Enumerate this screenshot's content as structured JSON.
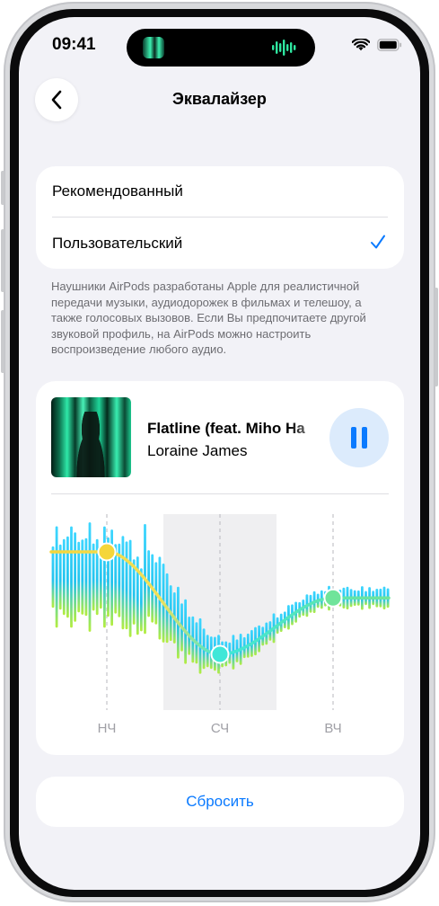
{
  "status_bar": {
    "time": "09:41"
  },
  "nav": {
    "title": "Эквалайзер"
  },
  "options": [
    {
      "label": "Рекомендованный",
      "selected": false
    },
    {
      "label": "Пользовательский",
      "selected": true
    }
  ],
  "footnote": "Наушники AirPods разработаны Apple для реалистичной передачи музыки, аудиодорожек в фильмах и телешоу, а также голосовых вызовов. Если Вы предпочитаете другой звуковой профиль, на AirPods можно настроить воспроизведение любого аудио.",
  "player": {
    "track_title": "Flatline (feat. Miho Ha",
    "artist": "Loraine James",
    "state": "playing"
  },
  "equalizer": {
    "bands": [
      {
        "label": "НЧ",
        "value": 1.0
      },
      {
        "label": "СЧ",
        "value": -1.0
      },
      {
        "label": "ВЧ",
        "value": 0.1
      }
    ],
    "handle_colors": [
      "#f5d63a",
      "#3fe7d8",
      "#6fe49a"
    ]
  },
  "actions": {
    "reset_label": "Сбросить"
  },
  "colors": {
    "accent": "#0a7aff",
    "background": "#f2f2f7"
  }
}
